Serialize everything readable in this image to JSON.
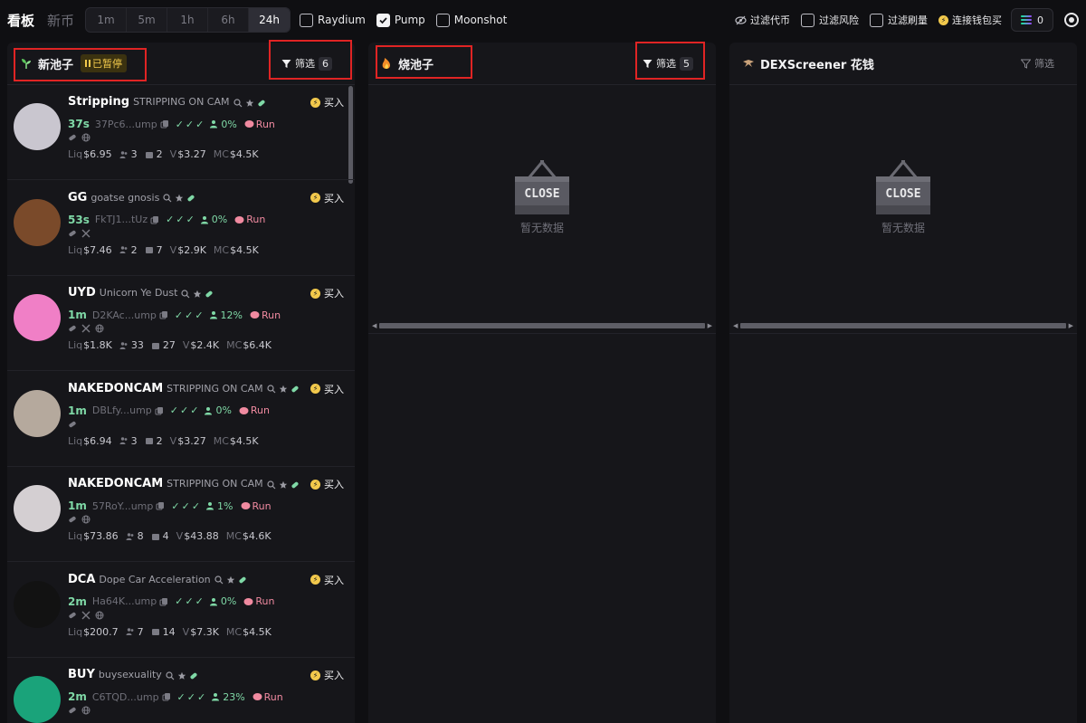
{
  "topbar": {
    "title": "看板",
    "title2": "新币",
    "time_tabs": [
      "1m",
      "5m",
      "1h",
      "6h",
      "24h"
    ],
    "active_tab": "24h",
    "platforms": [
      {
        "label": "Raydium",
        "checked": false
      },
      {
        "label": "Pump",
        "checked": true
      },
      {
        "label": "Moonshot",
        "checked": false
      }
    ],
    "filter_tokens_label": "过滤代币",
    "filter_risk_label": "过滤风险",
    "filter_wash_label": "过滤刷量",
    "connect_wallet_label": "连接钱包买",
    "balance": "0"
  },
  "columns": {
    "new_pool": {
      "title": "新池子",
      "paused_label": "已暂停",
      "filter_label": "筛选",
      "filter_count": "6"
    },
    "burn_pool": {
      "title": "烧池子",
      "filter_label": "筛选",
      "filter_count": "5",
      "sign_text": "CLOSE",
      "empty_text": "暂无数据"
    },
    "dex": {
      "title": "DEXScreener 花钱",
      "filter_label": "筛选",
      "sign_text": "CLOSE",
      "empty_text": "暂无数据"
    }
  },
  "labels": {
    "buy": "买入",
    "liq": "Liq",
    "v": "V",
    "mc": "MC",
    "run": "Run"
  },
  "tokens": [
    {
      "name": "Stripping",
      "full": "STRIPPING ON CAM",
      "age": "37s",
      "addr": "37Pc6...ump",
      "pct": "0%",
      "liq": "$6.95",
      "holders": "3",
      "txs": "2",
      "vol": "$3.27",
      "mc": "$4.5K",
      "socials": [
        "link",
        "web"
      ]
    },
    {
      "name": "GG",
      "full": "goatse gnosis",
      "age": "53s",
      "addr": "FkTJ1...tUz",
      "pct": "0%",
      "liq": "$7.46",
      "holders": "2",
      "txs": "7",
      "vol": "$2.9K",
      "mc": "$4.5K",
      "socials": [
        "link",
        "x"
      ]
    },
    {
      "name": "UYD",
      "full": "Unicorn Ye Dust",
      "age": "1m",
      "addr": "D2KAc...ump",
      "pct": "12%",
      "liq": "$1.8K",
      "holders": "33",
      "txs": "27",
      "vol": "$2.4K",
      "mc": "$6.4K",
      "socials": [
        "link",
        "x",
        "web"
      ]
    },
    {
      "name": "NAKEDONCAM",
      "full": "STRIPPING ON CAM",
      "age": "1m",
      "addr": "DBLfy...ump",
      "pct": "0%",
      "liq": "$6.94",
      "holders": "3",
      "txs": "2",
      "vol": "$3.27",
      "mc": "$4.5K",
      "socials": [
        "link"
      ]
    },
    {
      "name": "NAKEDONCAM",
      "full": "STRIPPING ON CAM",
      "age": "1m",
      "addr": "57RoY...ump",
      "pct": "1%",
      "liq": "$73.86",
      "holders": "8",
      "txs": "4",
      "vol": "$43.88",
      "mc": "$4.6K",
      "socials": [
        "link",
        "web"
      ]
    },
    {
      "name": "DCA",
      "full": "Dope Car Acceleration",
      "age": "2m",
      "addr": "Ha64K...ump",
      "pct": "0%",
      "liq": "$200.7",
      "holders": "7",
      "txs": "14",
      "vol": "$7.3K",
      "mc": "$4.5K",
      "socials": [
        "link",
        "x",
        "web"
      ]
    },
    {
      "name": "BUY",
      "full": "buysexuality",
      "age": "2m",
      "addr": "C6TQD...ump",
      "pct": "23%",
      "liq": "",
      "holders": "",
      "txs": "",
      "vol": "",
      "mc": "",
      "socials": [
        "link",
        "web"
      ]
    }
  ],
  "avatar_colors": [
    "#c9c6cf",
    "#7a4a2a",
    "#f07fc6",
    "#b5a99d",
    "#d4cfd2",
    "#121212",
    "#1aa37a"
  ]
}
